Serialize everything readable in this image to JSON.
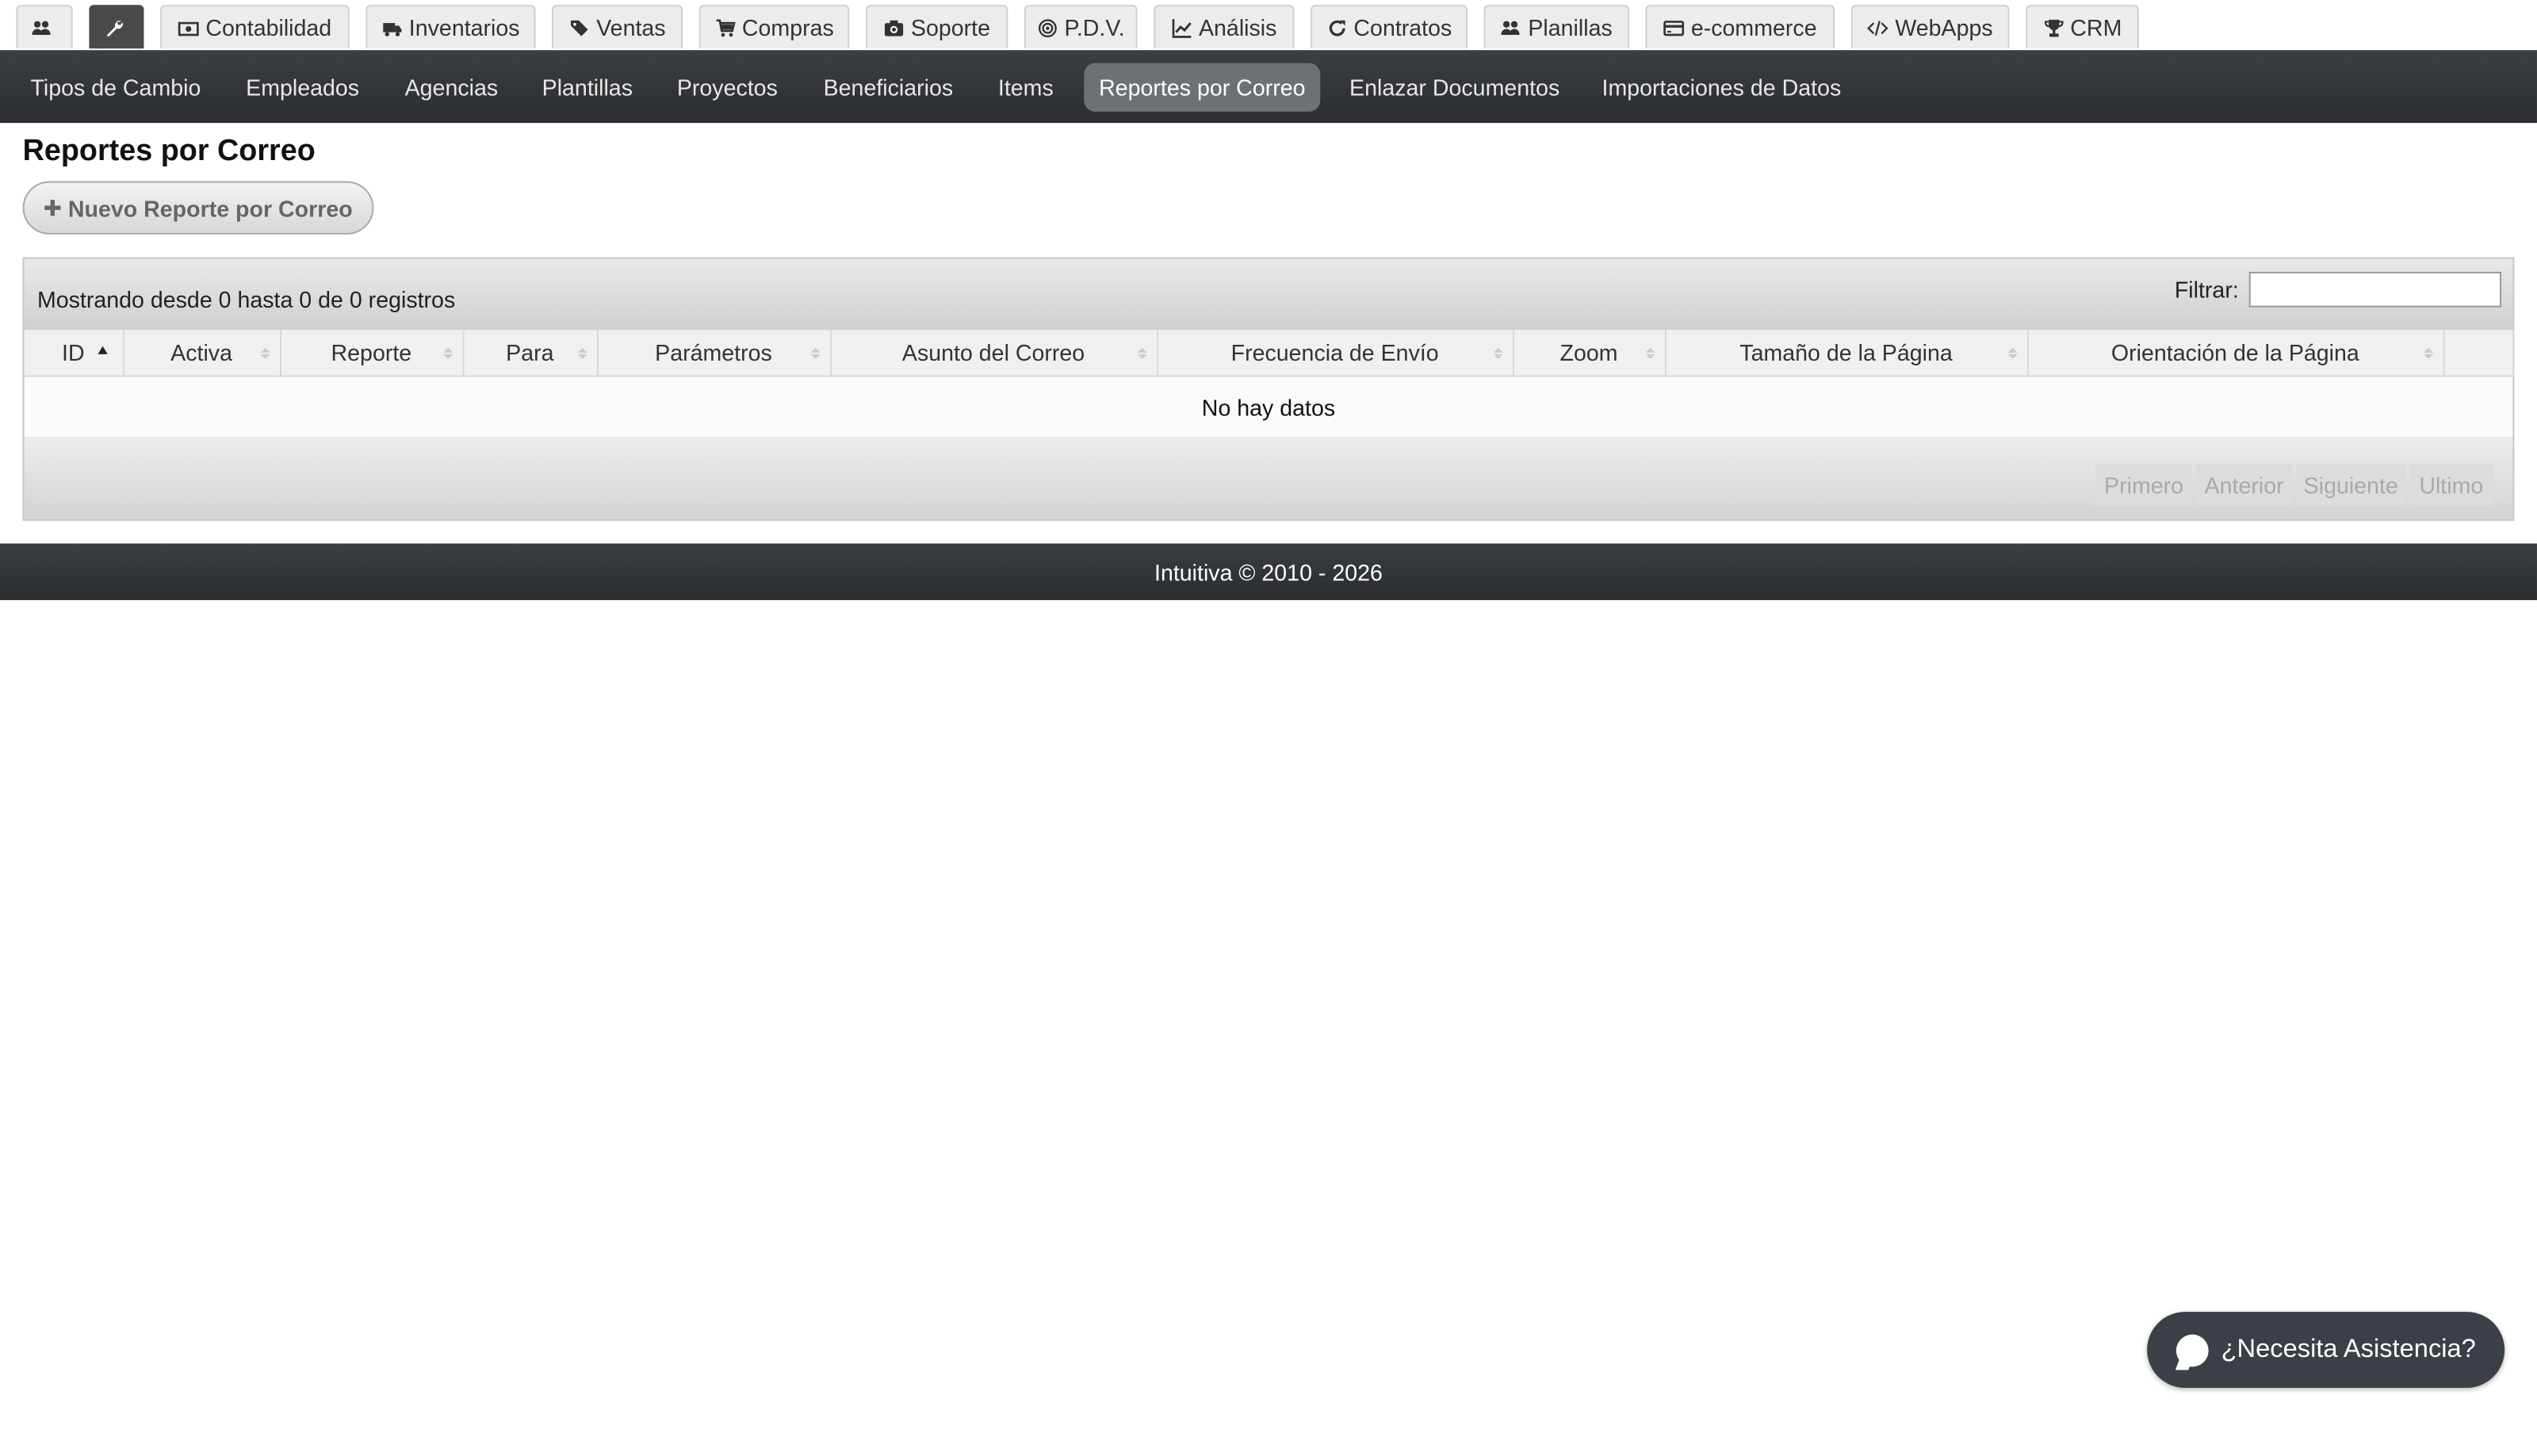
{
  "top_tabs": [
    {
      "label": "",
      "icon": "users-icon"
    },
    {
      "label": "",
      "icon": "wrench-icon",
      "active": true
    },
    {
      "label": "Contabilidad",
      "icon": "money-icon"
    },
    {
      "label": "Inventarios",
      "icon": "truck-icon"
    },
    {
      "label": "Ventas",
      "icon": "tags-icon"
    },
    {
      "label": "Compras",
      "icon": "cart-icon"
    },
    {
      "label": "Soporte",
      "icon": "camera-icon"
    },
    {
      "label": "P.D.V.",
      "icon": "target-icon"
    },
    {
      "label": "Análisis",
      "icon": "line-chart-icon"
    },
    {
      "label": "Contratos",
      "icon": "refresh-icon"
    },
    {
      "label": "Planillas",
      "icon": "users-icon"
    },
    {
      "label": "e-commerce",
      "icon": "credit-card-icon"
    },
    {
      "label": "WebApps",
      "icon": "code-icon"
    },
    {
      "label": "CRM",
      "icon": "trophy-icon"
    }
  ],
  "subnav": [
    {
      "label": "Tipos de Cambio"
    },
    {
      "label": "Empleados"
    },
    {
      "label": "Agencias"
    },
    {
      "label": "Plantillas"
    },
    {
      "label": "Proyectos"
    },
    {
      "label": "Beneficiarios"
    },
    {
      "label": "Items"
    },
    {
      "label": "Reportes por Correo",
      "active": true
    },
    {
      "label": "Enlazar Documentos"
    },
    {
      "label": "Importaciones de Datos"
    }
  ],
  "page": {
    "title": "Reportes por Correo",
    "new_button": "Nuevo Reporte por Correo"
  },
  "table": {
    "info": "Mostrando desde 0 hasta 0 de 0 registros",
    "filter_label": "Filtrar:",
    "filter_value": "",
    "columns": [
      "ID",
      "Activa",
      "Reporte",
      "Para",
      "Parámetros",
      "Asunto del Correo",
      "Frecuencia de Envío",
      "Zoom",
      "Tamaño de la Página",
      "Orientación de la Página",
      ""
    ],
    "sorted_column": "ID",
    "empty_text": "No hay datos",
    "pager": [
      "Primero",
      "Anterior",
      "Siguiente",
      "Ultimo"
    ]
  },
  "footer": {
    "text": "Intuitiva © 2010 - 2026"
  },
  "help": {
    "label": "¿Necesita Asistencia?"
  },
  "colors": {
    "nav_dark": "#2b2d30",
    "active_pill": "#6d7176",
    "help_bg": "#3b4047"
  }
}
